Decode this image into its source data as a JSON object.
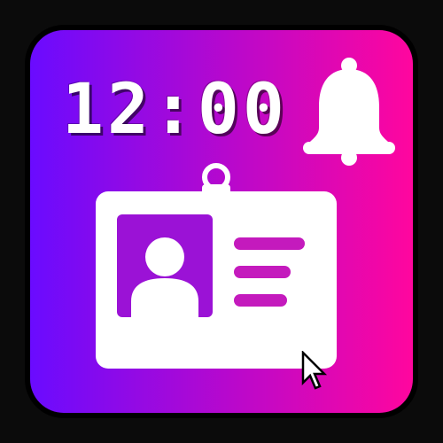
{
  "clock": {
    "time": "12:00"
  },
  "icons": {
    "bell": "bell-icon",
    "badge": "id-badge-icon",
    "avatar": "person-icon",
    "cursor": "mouse-pointer-icon"
  },
  "colors": {
    "gradient_start": "#6a0bff",
    "gradient_end": "#ff069e",
    "badge_fill": "#ffffff",
    "photo_bg": "#9b12d6",
    "line_color": "#c41abd",
    "frame": "#000000"
  }
}
